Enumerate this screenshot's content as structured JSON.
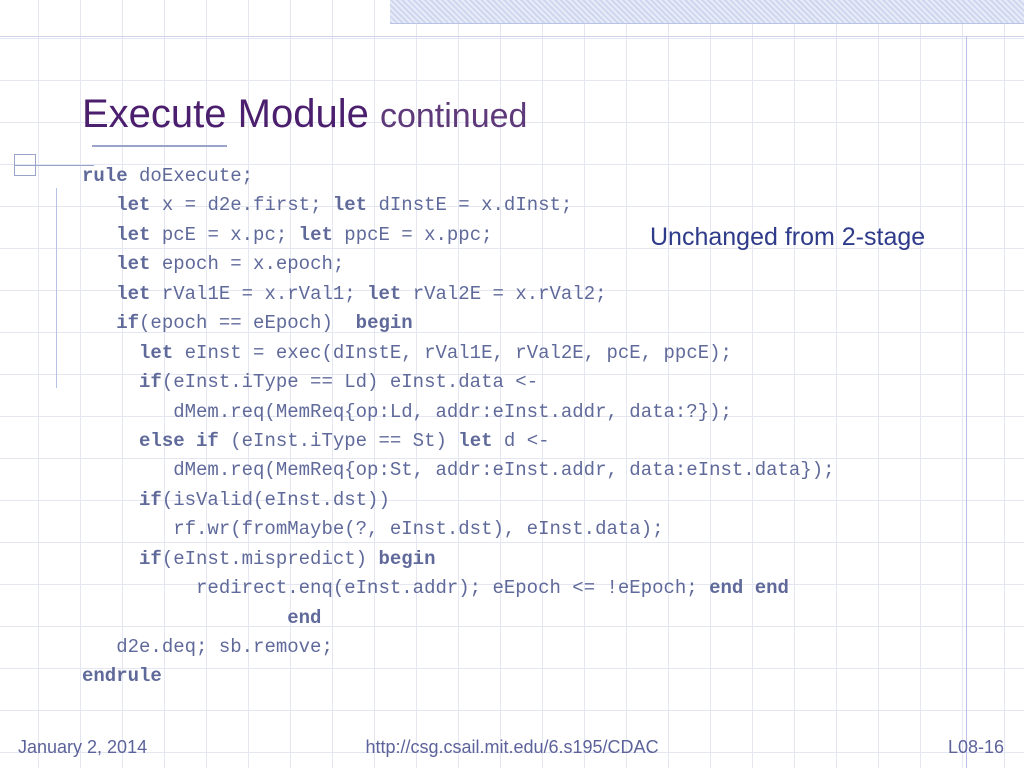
{
  "title": {
    "main": "Execute Module",
    "sub": "continued"
  },
  "annotation": "Unchanged from 2-stage",
  "code": {
    "l1": {
      "kw1": "rule",
      "r": " doExecute;"
    },
    "l2": {
      "kw1": "let",
      "a": " x = d2e.first; ",
      "kw2": "let",
      "b": " dInstE = x.dInst;"
    },
    "l3": {
      "kw1": "let",
      "a": " pcE = x.pc; ",
      "kw2": "let",
      "b": " ppcE = x.ppc;"
    },
    "l4": {
      "kw1": "let",
      "a": " epoch = x.epoch;"
    },
    "l5": {
      "kw1": "let",
      "a": " rVal1E = x.rVal1; ",
      "kw2": "let",
      "b": " rVal2E = x.rVal2;"
    },
    "l6": {
      "kw1": "if",
      "a": "(epoch == eEpoch)  ",
      "kw2": "begin"
    },
    "l7": {
      "kw1": "let",
      "a": " eInst = exec(dInstE, rVal1E, rVal2E, pcE, ppcE);"
    },
    "l8": {
      "kw1": "if",
      "a": "(eInst.iType == Ld) eInst.data <-"
    },
    "l9": {
      "a": "dMem.req(MemReq{op:Ld, addr:eInst.addr, data:?});"
    },
    "l10": {
      "kw1": "else if",
      "a": " (eInst.iType == St) ",
      "kw2": "let",
      "b": " d <-"
    },
    "l11": {
      "a": "dMem.req(MemReq{op:St, addr:eInst.addr, data:eInst.data});"
    },
    "l12": {
      "kw1": "if",
      "a": "(isValid(eInst.dst))"
    },
    "l13": {
      "a": "rf.wr(fromMaybe(?, eInst.dst), eInst.data);"
    },
    "l14": {
      "kw1": "if",
      "a": "(eInst.mispredict) ",
      "kw2": "begin"
    },
    "l15": {
      "a": "redirect.enq(eInst.addr); eEpoch <= !eEpoch; ",
      "kw1": "end end"
    },
    "l16": {
      "kw1": "end"
    },
    "l17": {
      "a": "d2e.deq; sb.remove;"
    },
    "l18": {
      "kw1": "endrule"
    }
  },
  "footer": {
    "date": "January 2, 2014",
    "url": "http://csg.csail.mit.edu/6.s195/CDAC",
    "page": "L08-16"
  }
}
